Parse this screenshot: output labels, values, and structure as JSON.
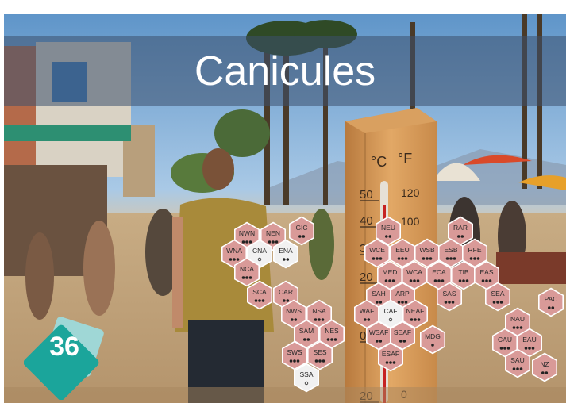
{
  "title": "Canicules",
  "badge_number": "36",
  "thermometer": {
    "celsius_label": "°C",
    "fahrenheit_label": "°F",
    "celsius_ticks": [
      "50",
      "40",
      "30",
      "20",
      "10",
      "0",
      "20"
    ],
    "fahrenheit_ticks": [
      "120",
      "100",
      "80",
      "60",
      "40",
      "20",
      "0"
    ]
  },
  "colors": {
    "hex_increase": "#d99a98",
    "hex_neutral": "#f1f1f1",
    "hex_stroke": "#ffffff",
    "title_band": "#3c506e",
    "badge_front": "#1ba59b",
    "badge_back": "#9fd7d6"
  },
  "regions": [
    {
      "code": "GIC",
      "dots": 2,
      "status": "increase"
    },
    {
      "code": "NWN",
      "dots": 3,
      "status": "increase"
    },
    {
      "code": "NEN",
      "dots": 3,
      "status": "increase"
    },
    {
      "code": "WNA",
      "dots": 3,
      "status": "increase"
    },
    {
      "code": "CNA",
      "dots": 1,
      "status": "neutral"
    },
    {
      "code": "ENA",
      "dots": 2,
      "status": "neutral"
    },
    {
      "code": "NCA",
      "dots": 3,
      "status": "increase"
    },
    {
      "code": "SCA",
      "dots": 3,
      "status": "increase"
    },
    {
      "code": "CAR",
      "dots": 2,
      "status": "increase"
    },
    {
      "code": "NWS",
      "dots": 2,
      "status": "increase"
    },
    {
      "code": "NSA",
      "dots": 3,
      "status": "increase"
    },
    {
      "code": "SAM",
      "dots": 2,
      "status": "increase"
    },
    {
      "code": "NES",
      "dots": 3,
      "status": "increase"
    },
    {
      "code": "SWS",
      "dots": 3,
      "status": "increase"
    },
    {
      "code": "SES",
      "dots": 3,
      "status": "increase"
    },
    {
      "code": "SSA",
      "dots": 1,
      "status": "neutral"
    },
    {
      "code": "NEU",
      "dots": 2,
      "status": "increase"
    },
    {
      "code": "RAR",
      "dots": 2,
      "status": "increase"
    },
    {
      "code": "WCE",
      "dots": 3,
      "status": "increase"
    },
    {
      "code": "EEU",
      "dots": 3,
      "status": "increase"
    },
    {
      "code": "WSB",
      "dots": 3,
      "status": "increase"
    },
    {
      "code": "ESB",
      "dots": 3,
      "status": "increase"
    },
    {
      "code": "RFE",
      "dots": 3,
      "status": "increase"
    },
    {
      "code": "MED",
      "dots": 3,
      "status": "increase"
    },
    {
      "code": "WCA",
      "dots": 3,
      "status": "increase"
    },
    {
      "code": "ECA",
      "dots": 3,
      "status": "increase"
    },
    {
      "code": "TIB",
      "dots": 3,
      "status": "increase"
    },
    {
      "code": "EAS",
      "dots": 3,
      "status": "increase"
    },
    {
      "code": "SAH",
      "dots": 2,
      "status": "increase"
    },
    {
      "code": "ARP",
      "dots": 3,
      "status": "increase"
    },
    {
      "code": "SAS",
      "dots": 3,
      "status": "increase"
    },
    {
      "code": "SEA",
      "dots": 3,
      "status": "increase"
    },
    {
      "code": "WAF",
      "dots": 2,
      "status": "increase"
    },
    {
      "code": "CAF",
      "dots": 1,
      "status": "neutral"
    },
    {
      "code": "NEAF",
      "dots": 3,
      "status": "increase"
    },
    {
      "code": "WSAF",
      "dots": 2,
      "status": "increase"
    },
    {
      "code": "SEAF",
      "dots": 2,
      "status": "increase"
    },
    {
      "code": "MDG",
      "dots": 1,
      "status": "increase"
    },
    {
      "code": "ESAF",
      "dots": 3,
      "status": "increase"
    },
    {
      "code": "PAC",
      "dots": 2,
      "status": "increase"
    },
    {
      "code": "NAU",
      "dots": 3,
      "status": "increase"
    },
    {
      "code": "CAU",
      "dots": 3,
      "status": "increase"
    },
    {
      "code": "EAU",
      "dots": 3,
      "status": "increase"
    },
    {
      "code": "SAU",
      "dots": 3,
      "status": "increase"
    },
    {
      "code": "NZ",
      "dots": 2,
      "status": "increase"
    }
  ]
}
